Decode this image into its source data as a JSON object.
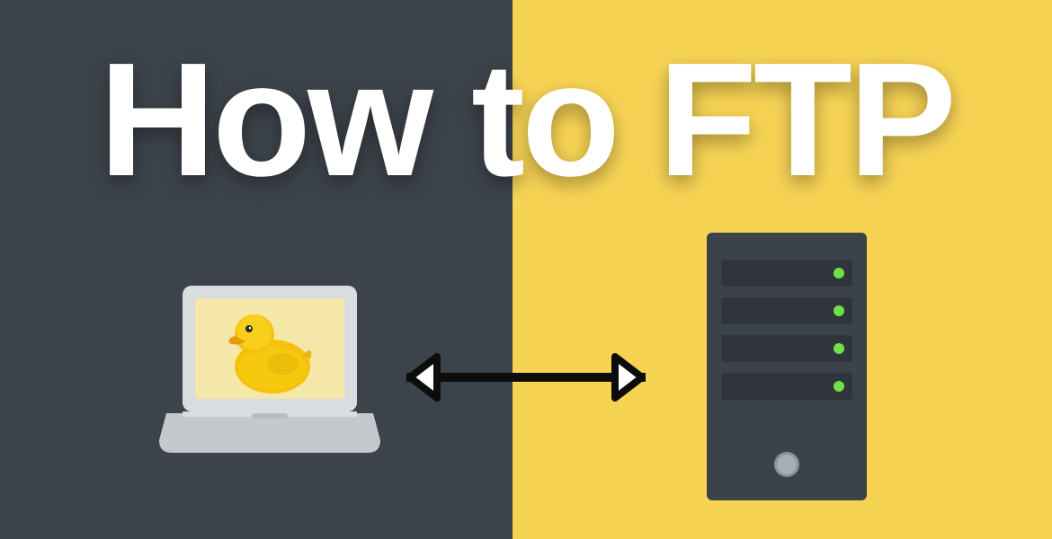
{
  "title": "How to FTP",
  "colors": {
    "bg_left": "#3c434a",
    "bg_right": "#f7d354",
    "title_color": "#ffffff",
    "server_body": "#3b4249",
    "server_led": "#6fe04a",
    "laptop_body": "#d9dde0",
    "laptop_screen": "#f5e7a7",
    "duck": "#f4c20d",
    "arrow": "#0c0c0c"
  },
  "icons": {
    "laptop": "laptop-with-duck-icon",
    "server": "server-rack-icon",
    "arrow": "bidirectional-arrow-icon"
  }
}
